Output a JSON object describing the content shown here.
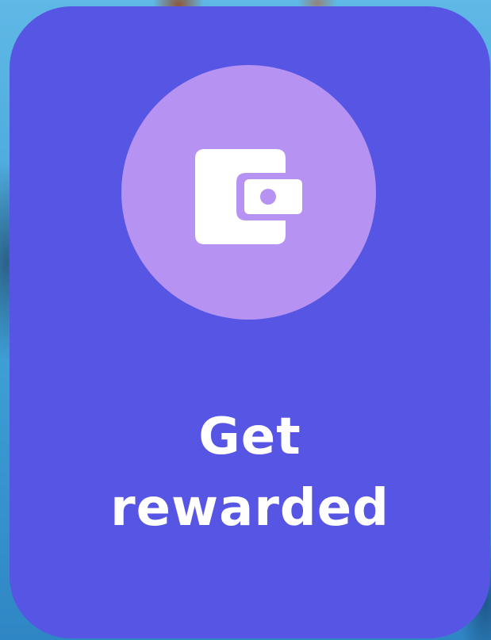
{
  "card": {
    "title_line1": "Get",
    "title_line2": "rewarded",
    "icon": "wallet-icon"
  },
  "colors": {
    "card_background": "#5755e4",
    "icon_circle": "#b693f2",
    "icon_fill": "#ffffff",
    "text": "#ffffff"
  }
}
